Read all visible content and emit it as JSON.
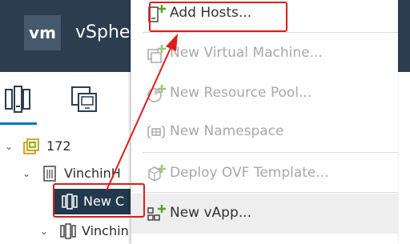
{
  "header": {
    "logo_text": "vm",
    "app_title": "vSphe"
  },
  "navigator": {
    "tabs": [
      {
        "icon": "hosts-clusters-icon"
      },
      {
        "icon": "vms-templates-icon"
      }
    ],
    "tree": [
      {
        "label": "172",
        "icon": "vcenter-icon",
        "caret": "v"
      },
      {
        "label": "VinchinH",
        "icon": "datacenter-icon",
        "caret": "v"
      },
      {
        "label": "New C",
        "icon": "cluster-icon",
        "selected": true
      },
      {
        "label": "Vinchin",
        "icon": "cluster-icon",
        "caret": "v"
      }
    ]
  },
  "context_menu": {
    "items": [
      {
        "label": "Add Hosts...",
        "enabled": true,
        "icon": "add-host-icon"
      },
      {
        "label": "New Virtual Machine...",
        "enabled": false,
        "icon": "new-vm-icon"
      },
      {
        "label": "New Resource Pool...",
        "enabled": false,
        "icon": "new-resource-pool-icon"
      },
      {
        "label": "New Namespace",
        "enabled": false,
        "icon": "new-namespace-icon"
      },
      {
        "label": "Deploy OVF Template...",
        "enabled": false,
        "icon": "deploy-ovf-icon"
      },
      {
        "label": "New vApp...",
        "enabled": true,
        "icon": "new-vapp-icon"
      }
    ]
  },
  "colors": {
    "header_bg": "#2c3d4f",
    "selected_bg": "#22394d",
    "annotation_red": "#e11b1b",
    "plus_green": "#5aa220",
    "tab_accent": "#0079b8"
  }
}
